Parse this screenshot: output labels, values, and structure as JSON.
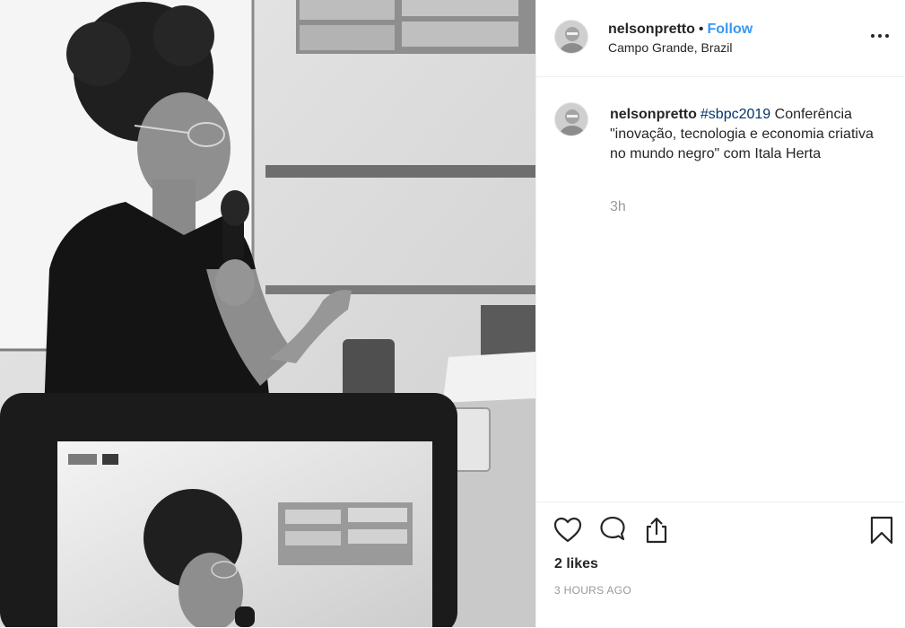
{
  "post": {
    "image_alt": "Black and white photo of a woman speaking into a microphone at a conference, with a tablet in the foreground displaying the same scene",
    "username": "nelsonpretto",
    "separator": "•",
    "follow_label": "Follow",
    "location": "Campo Grande, Brazil",
    "caption": {
      "username": "nelsonpretto",
      "hashtag": "#sbpc2019",
      "text": " Conferência \"inovação, tecnologia e economia criativa no mundo negro\" com Itala Herta",
      "time": "3h"
    },
    "likes": "2 likes",
    "posted_ago": "3 HOURS AGO"
  },
  "icons": {
    "more": "more-options-icon",
    "like": "heart-icon",
    "comment": "comment-icon",
    "share": "share-icon",
    "save": "bookmark-icon"
  },
  "colors": {
    "link": "#3897f0",
    "hashtag": "#003569",
    "secondary_text": "#999999",
    "border": "#efefef"
  }
}
